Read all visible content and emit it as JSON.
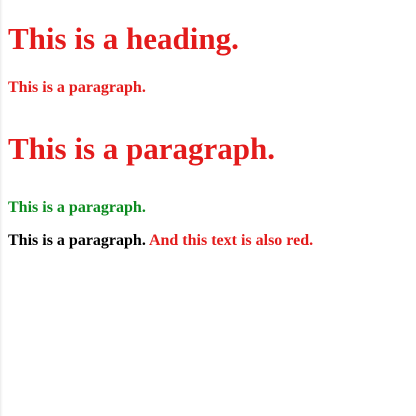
{
  "colors": {
    "red": "#e31b1b",
    "green": "#0b8a1e",
    "black": "#000000"
  },
  "content": {
    "heading": "This is a heading.",
    "paragraph_1": "This is a paragraph.",
    "paragraph_2": "This is a paragraph.",
    "paragraph_3": "This is a paragraph.",
    "paragraph_4_part_1": "This is a paragraph.",
    "paragraph_4_part_2": "And this text is also red."
  }
}
